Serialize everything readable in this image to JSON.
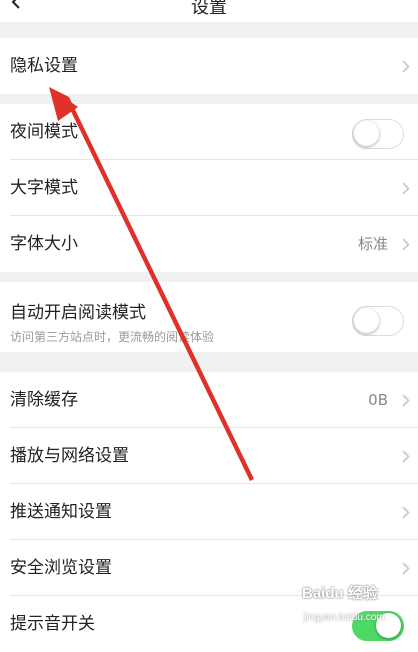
{
  "header": {
    "title": "设置",
    "back_icon": "chevron-left-icon"
  },
  "group1": {
    "privacy": {
      "label": "隐私设置"
    }
  },
  "group2": {
    "night_mode": {
      "label": "夜间模式",
      "enabled": false
    },
    "large_text": {
      "label": "大字模式"
    },
    "font_size": {
      "label": "字体大小",
      "value": "标准"
    }
  },
  "group3": {
    "auto_reader": {
      "label": "自动开启阅读模式",
      "description": "访问第三方站点时，更流畅的阅读体验",
      "enabled": false
    }
  },
  "group4": {
    "clear_cache": {
      "label": "清除缓存",
      "value": "0B"
    },
    "playback_network": {
      "label": "播放与网络设置"
    },
    "push_notifications": {
      "label": "推送通知设置"
    },
    "safe_browsing": {
      "label": "安全浏览设置"
    },
    "sound_switch": {
      "label": "提示音开关",
      "enabled": true
    }
  },
  "annotation": {
    "color": "#e0302a"
  },
  "watermark": {
    "logo": "Baidu 经验",
    "url": "jingyan.baidu.com"
  },
  "colors": {
    "toggle_on": "#4cd964",
    "chevron": "#c7c7cc",
    "background": "#f1f1f1"
  }
}
